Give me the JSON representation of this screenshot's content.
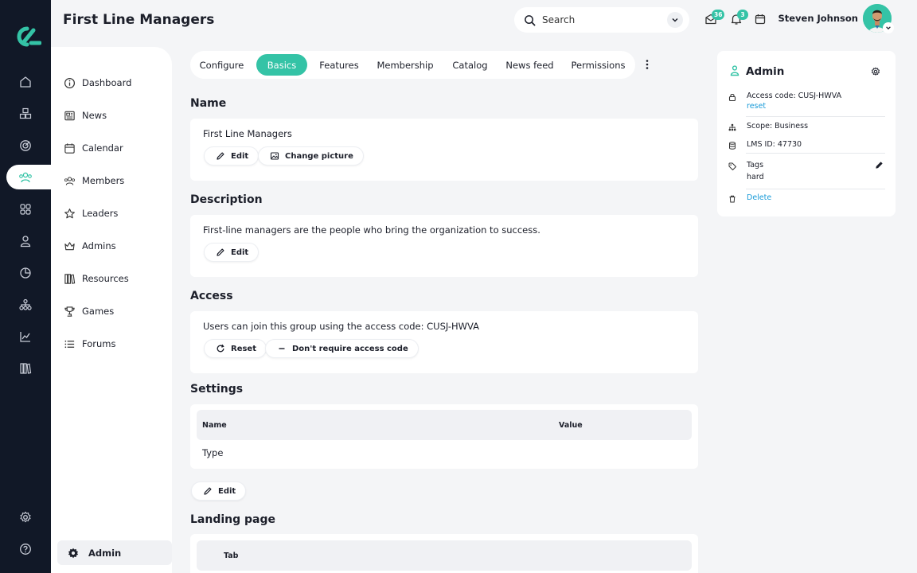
{
  "header": {
    "title": "First Line Managers",
    "search_placeholder": "Search",
    "messages_count": "36",
    "notifications_count": "3",
    "user_name": "Steven Johnson"
  },
  "rail": {
    "icons": [
      "home-icon",
      "cubes-icon",
      "target-icon",
      "users-icon",
      "apps-icon",
      "user-icon",
      "pie-chart-icon",
      "org-chart-icon",
      "line-chart-icon",
      "library-icon",
      "settings-icon",
      "help-icon"
    ],
    "active": "users-icon"
  },
  "sidebar": {
    "items": [
      {
        "label": "Dashboard",
        "icon": "info-circle-icon"
      },
      {
        "label": "News",
        "icon": "newspaper-icon"
      },
      {
        "label": "Calendar",
        "icon": "calendar-icon"
      },
      {
        "label": "Members",
        "icon": "members-icon"
      },
      {
        "label": "Leaders",
        "icon": "star-icon"
      },
      {
        "label": "Admins",
        "icon": "crown-icon"
      },
      {
        "label": "Resources",
        "icon": "books-icon"
      },
      {
        "label": "Games",
        "icon": "trophy-icon"
      },
      {
        "label": "Forums",
        "icon": "list-icon"
      }
    ],
    "footer_label": "Admin"
  },
  "tabs": {
    "items": [
      "Configure",
      "Basics",
      "Features",
      "Membership",
      "Catalog",
      "News feed",
      "Permissions"
    ],
    "active": "Basics"
  },
  "sections": {
    "name": {
      "title": "Name",
      "value": "First Line Managers",
      "edit_label": "Edit",
      "change_picture_label": "Change picture"
    },
    "description": {
      "title": "Description",
      "value": "First-line managers are the people who bring the organization to success.",
      "edit_label": "Edit"
    },
    "access": {
      "title": "Access",
      "value": "Users can join this group using the access code: CUSJ-HWVA",
      "reset_label": "Reset",
      "dont_require_label": "Don't require access code"
    },
    "settings": {
      "title": "Settings",
      "columns": [
        "Name",
        "Value"
      ],
      "rows": [
        {
          "name": "Type",
          "value": ""
        }
      ],
      "edit_label": "Edit"
    },
    "landing": {
      "title": "Landing page",
      "columns": [
        "Tab"
      ]
    }
  },
  "admin_panel": {
    "title": "Admin",
    "access_code_label": "Access code: CUSJ-HWVA",
    "reset_link": "reset",
    "scope": "Scope: Business",
    "lms_id": "LMS ID: 47730",
    "tags_label": "Tags",
    "tags_value": "hard",
    "delete_label": "Delete"
  },
  "colors": {
    "accent": "#34c3a6",
    "rail_bg": "#111827",
    "link": "#1a9bd8",
    "page_bg": "#f4f5f7"
  }
}
